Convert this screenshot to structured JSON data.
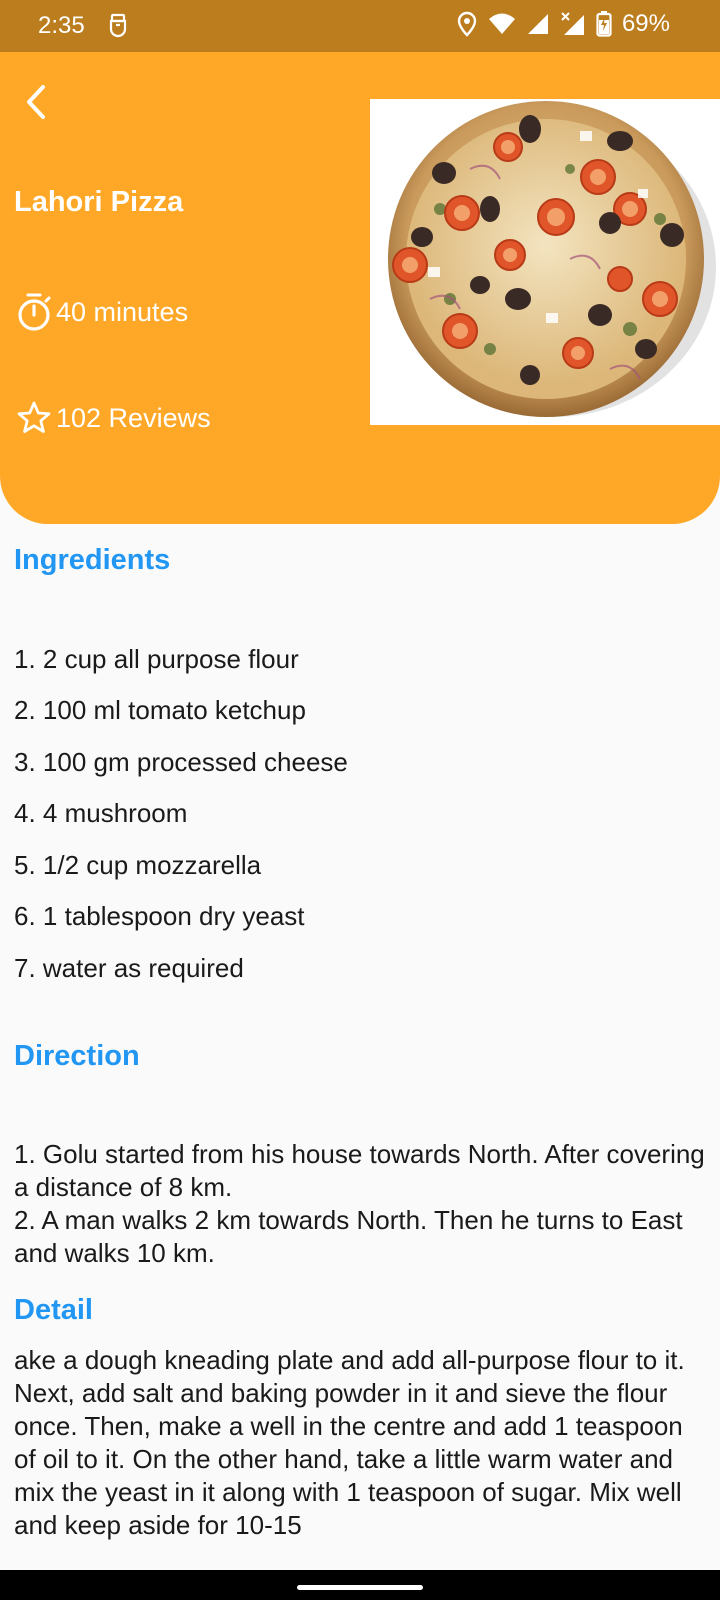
{
  "status_bar": {
    "time": "2:35",
    "battery": "69%",
    "icons": [
      "usb-icon",
      "location-icon",
      "wifi-icon",
      "signal-icon",
      "signal-no-data-icon",
      "battery-charging-icon"
    ]
  },
  "header": {
    "back_icon": "chevron-left-icon",
    "title": "Lahori Pizza",
    "time_icon": "timer-icon",
    "time": "40 minutes",
    "reviews_icon": "star-outline-icon",
    "reviews": "102 Reviews",
    "image": "pizza-photo"
  },
  "ingredients": {
    "heading": "Ingredients",
    "items": [
      "1. 2 cup all purpose flour",
      "2. 100 ml tomato ketchup",
      "3. 100 gm processed cheese",
      "4. 4 mushroom",
      "5. 1/2 cup mozzarella",
      "6. 1 tablespoon dry yeast",
      "7. water as required"
    ]
  },
  "direction": {
    "heading": "Direction",
    "lines": [
      "1. Golu started from his house towards North. After covering a distance of 8 km.",
      "2. A man walks 2 km towards North. Then he turns to East and walks 10 km."
    ]
  },
  "detail": {
    "heading": "Detail",
    "text": "ake a dough kneading plate and add all-purpose flour to it. Next, add salt and baking powder in it and sieve the flour once. Then, make a well in the centre and add 1 teaspoon of oil to it. On the other hand, take a little warm water and mix the yeast in it along with 1 teaspoon of sugar. Mix well and keep aside for 10-15"
  },
  "colors": {
    "status_bar": "#bc7d1f",
    "header": "#ffa726",
    "heading": "#2196f3",
    "background": "#fafafa"
  }
}
